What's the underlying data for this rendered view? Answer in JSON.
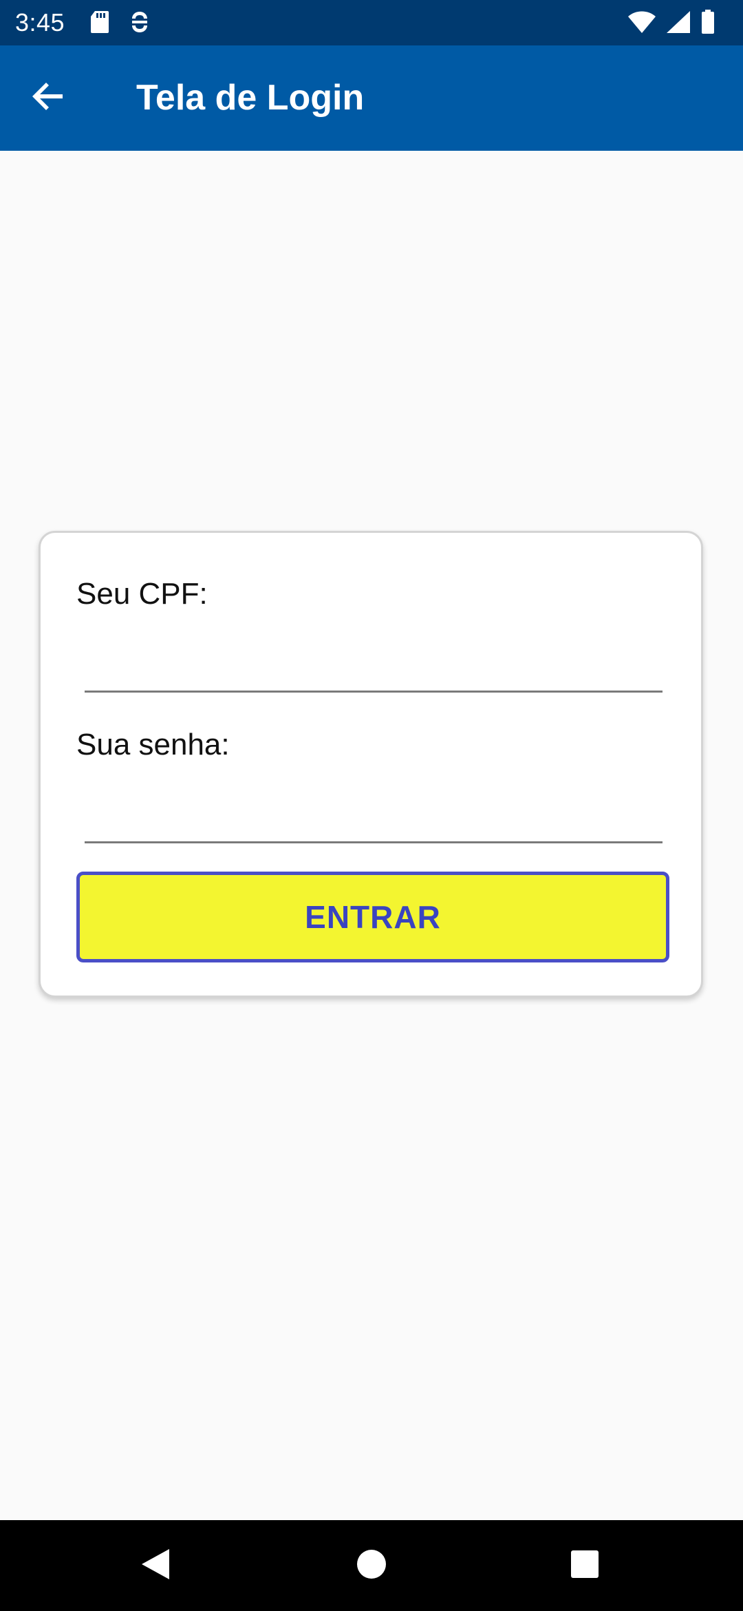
{
  "status_bar": {
    "time": "3:45",
    "icons_left": [
      "sd-card-icon",
      "sync-icon"
    ],
    "icons_right": [
      "wifi-icon",
      "signal-icon",
      "battery-icon"
    ],
    "background": "#003a70"
  },
  "app_bar": {
    "title": "Tela de Login",
    "back_icon": "arrow-back-icon",
    "background": "#005aa5"
  },
  "form": {
    "cpf_label": "Seu CPF:",
    "cpf_value": "",
    "password_label": "Sua senha:",
    "password_value": "",
    "submit_label": "ENTRAR",
    "submit_background": "#f3f530",
    "submit_text_color": "#3a44c0"
  },
  "nav_bar": {
    "buttons": [
      "back-triangle-icon",
      "home-circle-icon",
      "recents-square-icon"
    ]
  }
}
